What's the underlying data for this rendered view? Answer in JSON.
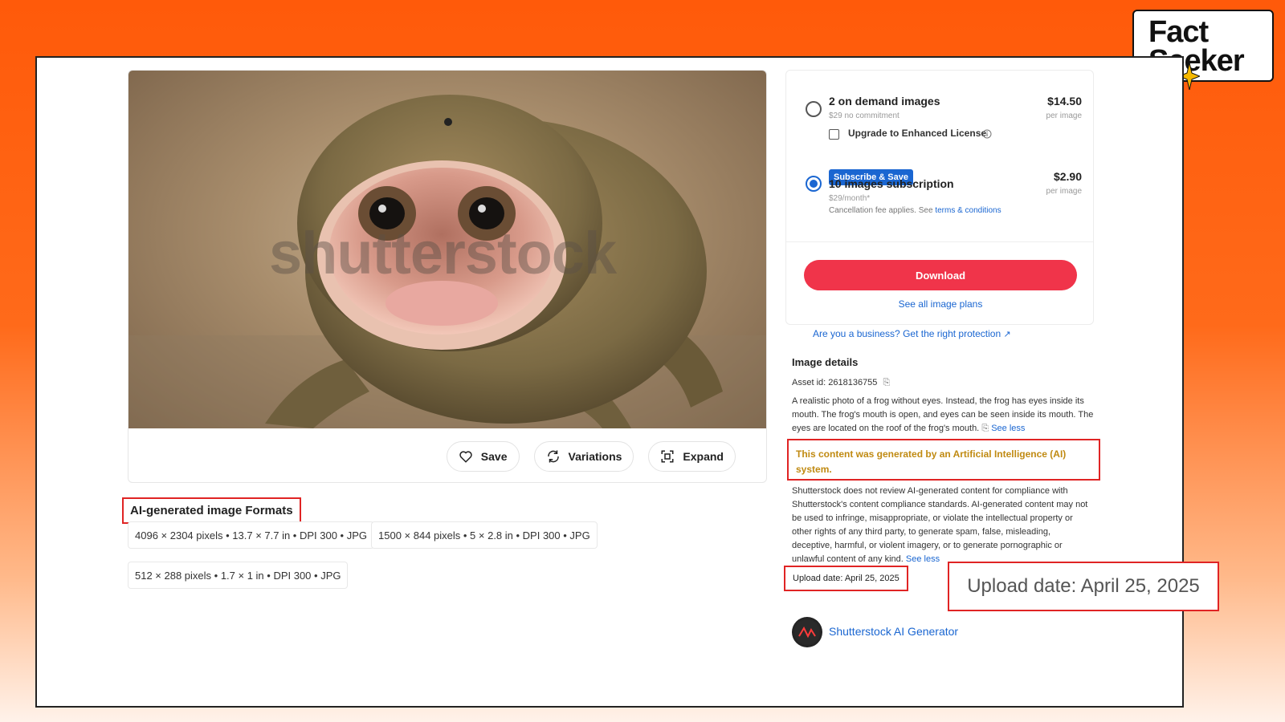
{
  "logo": {
    "line1": "Fact",
    "line2": "Seeker"
  },
  "photo": {
    "watermark": "shutterstock"
  },
  "actions": {
    "save": "Save",
    "variations": "Variations",
    "expand": "Expand"
  },
  "formats": {
    "title": "AI-generated image Formats",
    "items": [
      "4096 × 2304 pixels • 13.7 × 7.7 in • DPI 300 • JPG",
      "1500 × 844 pixels • 5 × 2.8 in • DPI 300 • JPG",
      "512 × 288 pixels • 1.7 × 1 in • DPI 300 • JPG"
    ]
  },
  "plans": {
    "on_demand": {
      "title": "2 on demand images",
      "sub": "$29 no commitment",
      "price": "$14.50",
      "unit": "per image",
      "selected": false
    },
    "enhanced": {
      "label": "Upgrade to Enhanced License",
      "info_icon": "info-icon"
    },
    "subscription": {
      "badge": "Subscribe & Save",
      "title": "10 images subscription",
      "sub": "$29/month*",
      "note": "Cancellation fee applies. See",
      "note_link": "terms & conditions",
      "price": "$2.90",
      "unit": "per image",
      "selected": true
    },
    "download": "Download",
    "see_all": "See all image plans"
  },
  "business_link": "Are you a business? Get the right protection",
  "details": {
    "heading": "Image details",
    "asset_id": "Asset id: 2618136755",
    "description": "A realistic photo of a frog without eyes. Instead, the frog has eyes inside its mouth. The frog's mouth is open, and eyes can be seen inside its mouth. The eyes are located on the roof of the frog's mouth.",
    "see_less": "See less",
    "ai_notice": "This content was generated by an Artificial Intelligence (AI) system.",
    "disclaimer": "Shutterstock does not review AI-generated content for compliance with Shutterstock's content compliance standards. AI-generated content may not be used to infringe, misappropriate, or violate the intellectual property or other rights of any third party, to generate spam, false, misleading, deceptive, harmful, or violent imagery, or to generate pornographic or unlawful content of any kind.",
    "see_less_2": "See less",
    "upload_date": "Upload date: April 25, 2025",
    "upload_date_zoom": "Upload date: April 25, 2025",
    "generator": "Shutterstock AI Generator"
  },
  "colors": {
    "accent": "#1a66d1",
    "download": "#f0344a",
    "highlight": "#e02424",
    "warning": "#c08a12",
    "background": "#ff5a0a"
  }
}
